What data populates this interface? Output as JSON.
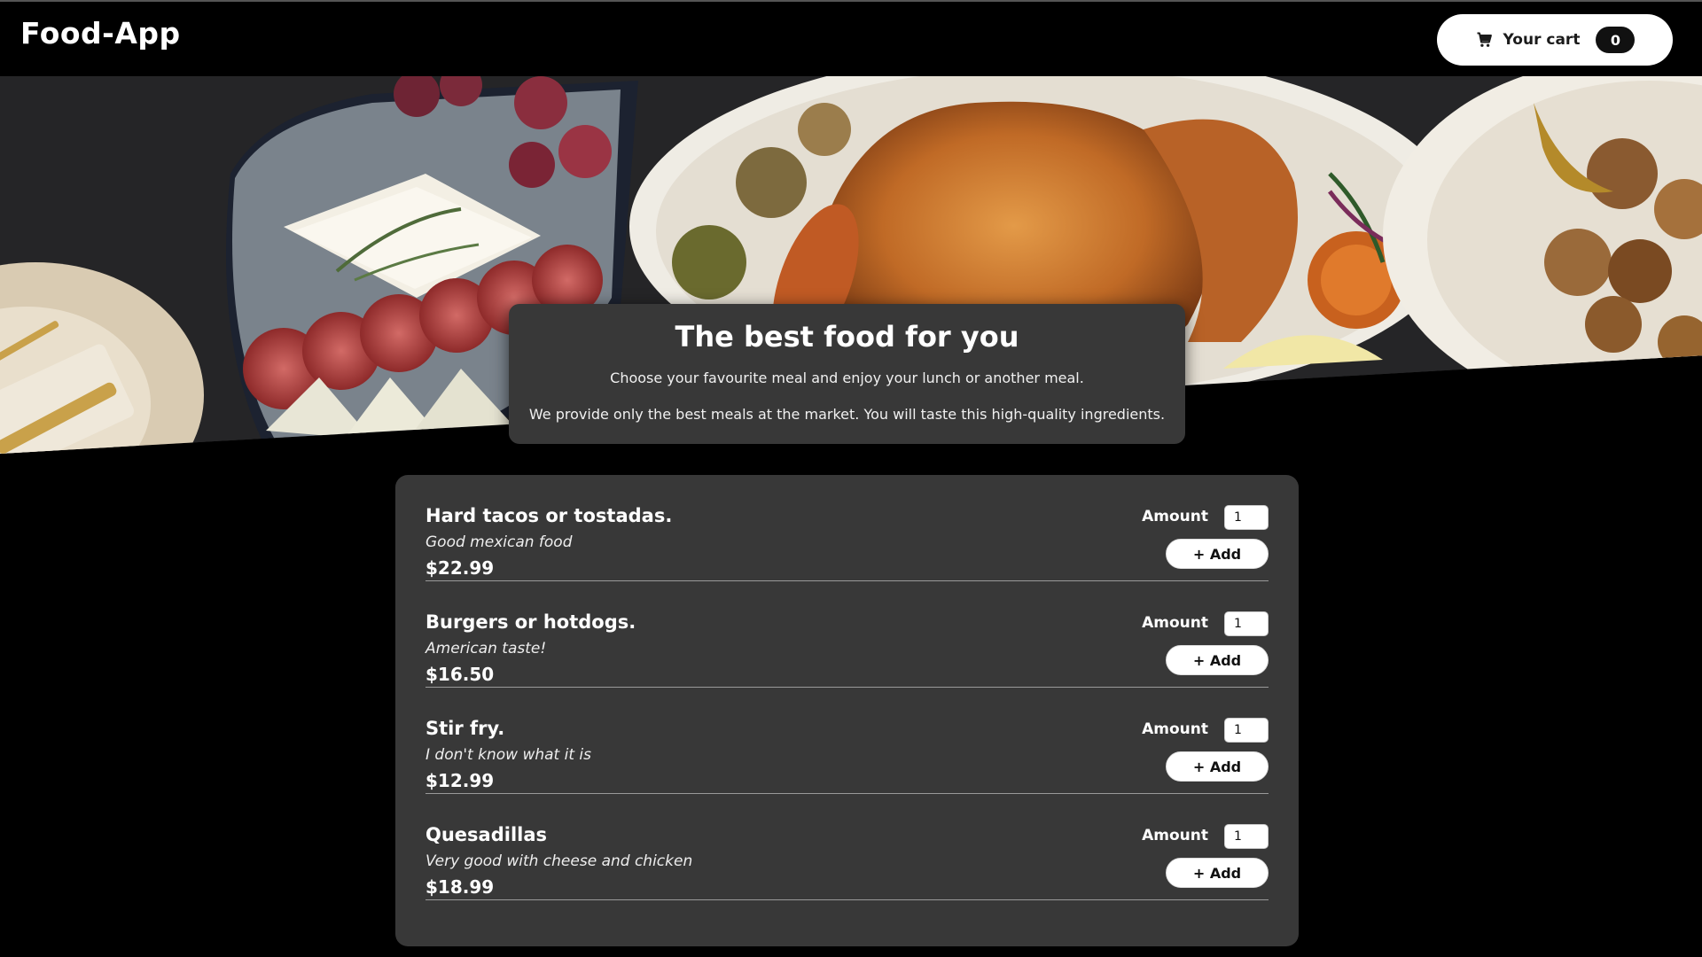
{
  "header": {
    "logo": "Food-App",
    "cart": {
      "icon": "shopping-cart-icon",
      "label": "Your cart",
      "count": "0"
    }
  },
  "hero": {
    "image": "food-banner-image"
  },
  "intro": {
    "title": "The best food for you",
    "line1": "Choose your favourite meal and enjoy your lunch or another meal.",
    "line2": "We provide only the best meals at the market. You will taste this high-quality ingredients."
  },
  "meals": [
    {
      "name": "Hard tacos or tostadas.",
      "description": "Good mexican food",
      "price": "$22.99",
      "amount_label": "Amount",
      "amount": "1",
      "add_label": "+ Add"
    },
    {
      "name": "Burgers or hotdogs.",
      "description": "American taste!",
      "price": "$16.50",
      "amount_label": "Amount",
      "amount": "1",
      "add_label": "+ Add"
    },
    {
      "name": "Stir fry.",
      "description": "I don't know what it is",
      "price": "$12.99",
      "amount_label": "Amount",
      "amount": "1",
      "add_label": "+ Add"
    },
    {
      "name": "Quesadillas",
      "description": "Very good with cheese and chicken",
      "price": "$18.99",
      "amount_label": "Amount",
      "amount": "1",
      "add_label": "+ Add"
    }
  ],
  "colors": {
    "background": "#000000",
    "card": "#383838",
    "button": "#ffffff",
    "badge": "#111111"
  }
}
